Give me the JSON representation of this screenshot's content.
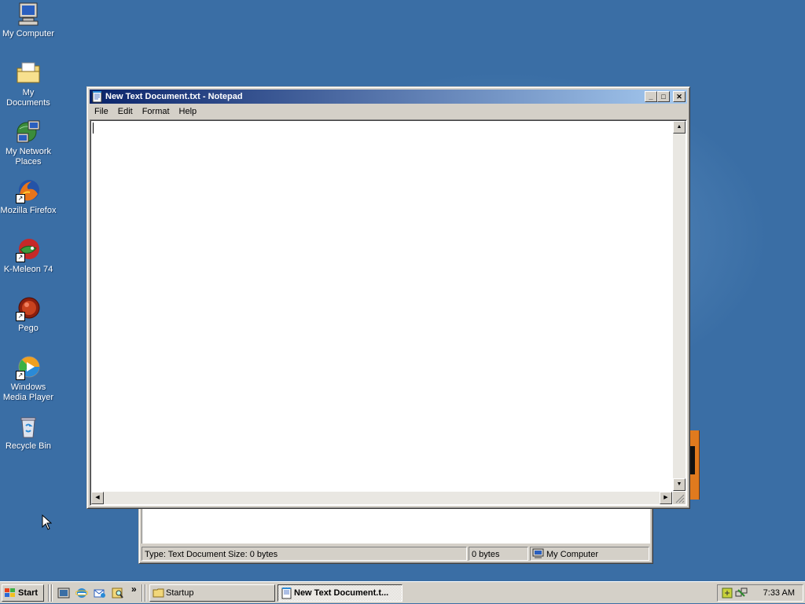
{
  "desktop": {
    "icons": [
      {
        "label": "My Computer",
        "icon": "my-computer-icon"
      },
      {
        "label": "My Documents",
        "icon": "my-documents-icon"
      },
      {
        "label": "My Network Places",
        "icon": "network-places-icon"
      },
      {
        "label": "Mozilla Firefox",
        "icon": "firefox-icon"
      },
      {
        "label": "K-Meleon 74",
        "icon": "k-meleon-icon"
      },
      {
        "label": "Pego",
        "icon": "pego-icon"
      },
      {
        "label": "Windows Media Player",
        "icon": "media-player-icon"
      },
      {
        "label": "Recycle Bin",
        "icon": "recycle-bin-icon"
      }
    ]
  },
  "notepad": {
    "title": "New Text Document.txt - Notepad",
    "menu": [
      "File",
      "Edit",
      "Format",
      "Help"
    ],
    "content": ""
  },
  "explorer": {
    "status_type": "Type: Text Document Size: 0 bytes",
    "status_size": "0 bytes",
    "status_zone": "My Computer"
  },
  "taskbar": {
    "start_label": "Start",
    "quicklaunch_more": "»",
    "tasks": [
      {
        "label": "Startup",
        "active": false
      },
      {
        "label": "New Text Document.t...",
        "active": true
      }
    ],
    "clock": "7:33 AM"
  },
  "colors": {
    "desktop": "#3a6ea5",
    "titlebar_start": "#0a246a",
    "titlebar_end": "#a6caf0",
    "face": "#d4d0c8"
  }
}
